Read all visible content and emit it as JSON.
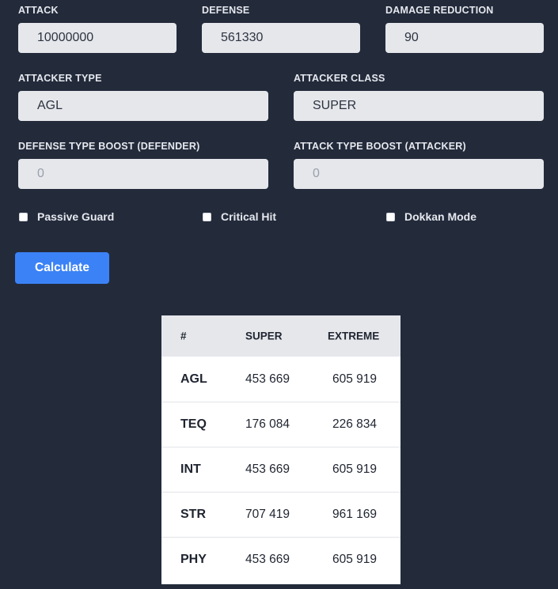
{
  "fields": {
    "attack": {
      "label": "ATTACK",
      "value": "10000000"
    },
    "defense": {
      "label": "DEFENSE",
      "value": "561330"
    },
    "damage_reduction": {
      "label": "DAMAGE REDUCTION",
      "value": "90"
    },
    "attacker_type": {
      "label": "ATTACKER TYPE",
      "value": "AGL"
    },
    "attacker_class": {
      "label": "ATTACKER CLASS",
      "value": "SUPER"
    },
    "defense_type_boost": {
      "label": "DEFENSE TYPE BOOST (DEFENDER)",
      "placeholder": "0"
    },
    "attack_type_boost": {
      "label": "ATTACK TYPE BOOST (ATTACKER)",
      "placeholder": "0"
    }
  },
  "checkboxes": {
    "passive_guard": {
      "label": "Passive Guard",
      "checked": false
    },
    "critical_hit": {
      "label": "Critical Hit",
      "checked": false
    },
    "dokkan_mode": {
      "label": "Dokkan Mode",
      "checked": false
    }
  },
  "calculate_label": "Calculate",
  "results": {
    "headers": [
      "#",
      "SUPER",
      "EXTREME"
    ],
    "rows": [
      {
        "type": "AGL",
        "super": "453 669",
        "extreme": "605 919"
      },
      {
        "type": "TEQ",
        "super": "176 084",
        "extreme": "226 834"
      },
      {
        "type": "INT",
        "super": "453 669",
        "extreme": "605 919"
      },
      {
        "type": "STR",
        "super": "707 419",
        "extreme": "961 169"
      },
      {
        "type": "PHY",
        "super": "453 669",
        "extreme": "605 919"
      }
    ]
  }
}
